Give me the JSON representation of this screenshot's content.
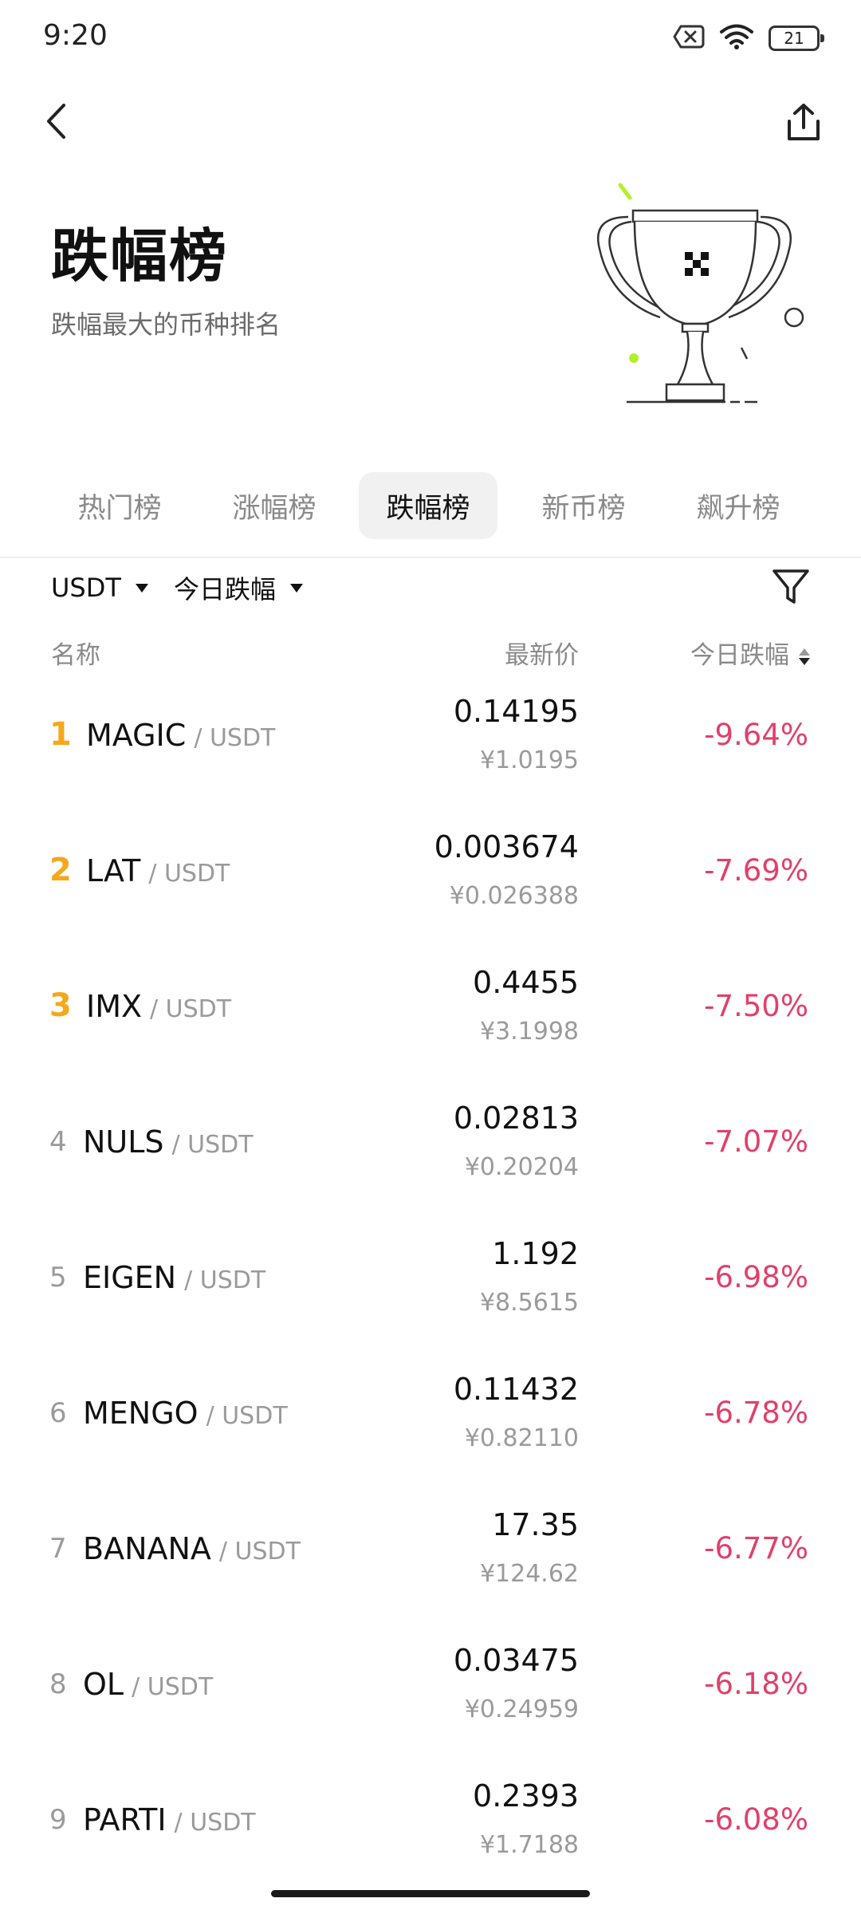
{
  "status": {
    "time": "9:20",
    "battery": "21"
  },
  "header": {
    "title": "跌幅榜",
    "subtitle": "跌幅最大的币种排名"
  },
  "tabs": [
    {
      "label": "热门榜",
      "active": false
    },
    {
      "label": "涨幅榜",
      "active": false
    },
    {
      "label": "跌幅榜",
      "active": true
    },
    {
      "label": "新币榜",
      "active": false
    },
    {
      "label": "飙升榜",
      "active": false
    }
  ],
  "filters": {
    "quote_currency": "USDT",
    "change_period": "今日跌幅"
  },
  "columns": {
    "name": "名称",
    "price": "最新价",
    "change": "今日跌幅"
  },
  "colors": {
    "top_rank": "#f4a81c",
    "negative": "#e0406a",
    "active_tab_bg": "#f1f1f1"
  },
  "rows": [
    {
      "rank": "1",
      "base": "MAGIC",
      "quote": "/ USDT",
      "price": "0.14195",
      "cny": "¥1.0195",
      "change": "-9.64%"
    },
    {
      "rank": "2",
      "base": "LAT",
      "quote": "/ USDT",
      "price": "0.003674",
      "cny": "¥0.026388",
      "change": "-7.69%"
    },
    {
      "rank": "3",
      "base": "IMX",
      "quote": "/ USDT",
      "price": "0.4455",
      "cny": "¥3.1998",
      "change": "-7.50%"
    },
    {
      "rank": "4",
      "base": "NULS",
      "quote": "/ USDT",
      "price": "0.02813",
      "cny": "¥0.20204",
      "change": "-7.07%"
    },
    {
      "rank": "5",
      "base": "EIGEN",
      "quote": "/ USDT",
      "price": "1.192",
      "cny": "¥8.5615",
      "change": "-6.98%"
    },
    {
      "rank": "6",
      "base": "MENGO",
      "quote": "/ USDT",
      "price": "0.11432",
      "cny": "¥0.82110",
      "change": "-6.78%"
    },
    {
      "rank": "7",
      "base": "BANANA",
      "quote": "/ USDT",
      "price": "17.35",
      "cny": "¥124.62",
      "change": "-6.77%"
    },
    {
      "rank": "8",
      "base": "OL",
      "quote": "/ USDT",
      "price": "0.03475",
      "cny": "¥0.24959",
      "change": "-6.18%"
    },
    {
      "rank": "9",
      "base": "PARTI",
      "quote": "/ USDT",
      "price": "0.2393",
      "cny": "¥1.7188",
      "change": "-6.08%"
    }
  ]
}
